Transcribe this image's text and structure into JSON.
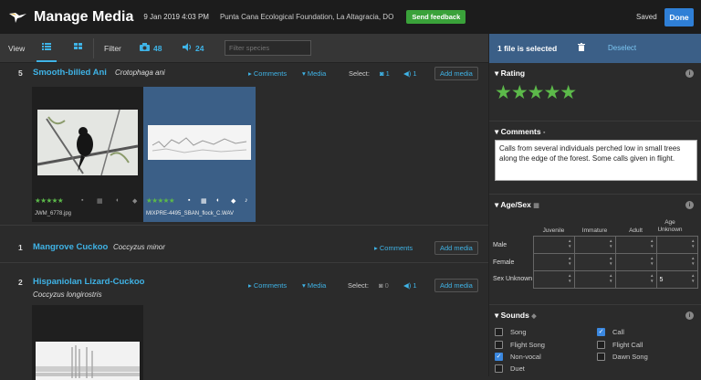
{
  "header": {
    "title": "Manage Media",
    "date": "9 Jan 2019 4:03 PM",
    "location": "Punta Cana Ecological Foundation, La Altagracia, DO",
    "feedback_label": "Send feedback",
    "saved_label": "Saved",
    "done_label": "Done"
  },
  "filterbar": {
    "view_label": "View",
    "filter_label": "Filter",
    "photo_count": "48",
    "audio_count": "24",
    "search_placeholder": "Filter species"
  },
  "species": [
    {
      "count": "5",
      "common_name": "Smooth-billed Ani",
      "scientific_name": "Crotophaga ani",
      "comments_label": "Comments",
      "media_label": "Media",
      "select_label": "Select:",
      "photo_selected": "1",
      "audio_selected": "1",
      "add_label": "Add media",
      "media": [
        {
          "filename": "JWM_6778.jpg",
          "rating": 4,
          "stars": "★★★★★"
        },
        {
          "filename": "MIXPRE-4495_SBAN_flock_C.WAV",
          "rating": 5,
          "stars": "★★★★★"
        }
      ]
    },
    {
      "count": "1",
      "common_name": "Mangrove Cuckoo",
      "scientific_name": "Coccyzus minor",
      "comments_label": "Comments",
      "add_label": "Add media"
    },
    {
      "count": "2",
      "common_name": "Hispaniolan Lizard-Cuckoo",
      "scientific_name": "Coccyzus longirostris",
      "comments_label": "Comments",
      "media_label": "Media",
      "select_label": "Select:",
      "photo_selected": "0",
      "audio_selected": "1",
      "add_label": "Add media"
    }
  ],
  "panel": {
    "selected_label": "1 file is selected",
    "deselect_label": "Deselect",
    "rating_title": "Rating",
    "rating_value": 5,
    "rating_stars": "★★★★★",
    "comments_title": "Comments",
    "comments_text": "Calls from several individuals perched low in small trees along the edge of the forest. Some calls given in flight.",
    "agesex_title": "Age/Sex",
    "agesex_columns": [
      "Juvenile",
      "Immature",
      "Adult",
      "Age Unknown"
    ],
    "agesex_rows": [
      {
        "label": "Male",
        "values": [
          "",
          "",
          "",
          ""
        ]
      },
      {
        "label": "Female",
        "values": [
          "",
          "",
          "",
          ""
        ]
      },
      {
        "label": "Sex Unknown",
        "values": [
          "",
          "",
          "",
          "5"
        ]
      }
    ],
    "sounds_title": "Sounds",
    "sounds": [
      {
        "label": "Song",
        "checked": false
      },
      {
        "label": "Call",
        "checked": true
      },
      {
        "label": "Flight Song",
        "checked": false
      },
      {
        "label": "Flight Call",
        "checked": false
      },
      {
        "label": "Non-vocal",
        "checked": true
      },
      {
        "label": "Dawn Song",
        "checked": false
      },
      {
        "label": "Duet",
        "checked": false
      }
    ]
  },
  "colors": {
    "accent": "#3fb3e6",
    "star": "#5cb94a",
    "feedback": "#3aa23a",
    "done": "#2f7fd6",
    "panel_header": "#3b5f87"
  }
}
